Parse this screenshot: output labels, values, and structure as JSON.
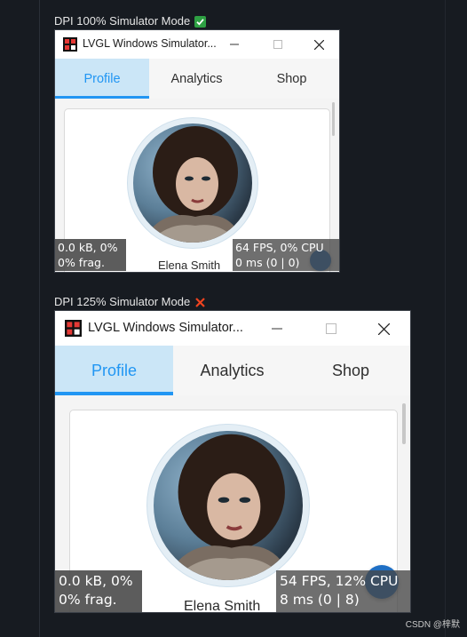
{
  "sections": [
    {
      "label": "DPI 100% Simulator Mode",
      "status_icon": "check-icon",
      "status_color": "#2ea043",
      "window": {
        "title": "LVGL Windows Simulator...",
        "tabs": [
          "Profile",
          "Analytics",
          "Shop"
        ],
        "active_tab": "Profile",
        "profile_name": "Elena Smith",
        "mem_overlay": "0.0 kB, 0%\n0% frag.",
        "perf_overlay": "64 FPS, 0% CPU\n0 ms (0 | 0)"
      }
    },
    {
      "label": "DPI 125% Simulator Mode",
      "status_icon": "cross-icon",
      "status_color": "#f0441f",
      "window": {
        "title": "LVGL Windows Simulator...",
        "tabs": [
          "Profile",
          "Analytics",
          "Shop"
        ],
        "active_tab": "Profile",
        "profile_name": "Elena Smith",
        "mem_overlay": "0.0 kB, 0%\n0% frag.",
        "perf_overlay": "54 FPS, 12% CPU\n8 ms (0 | 8)"
      }
    }
  ],
  "watermark": "CSDN @梓默",
  "colors": {
    "accent": "#2196f3",
    "tab_active_bg": "#cbe6f7"
  }
}
